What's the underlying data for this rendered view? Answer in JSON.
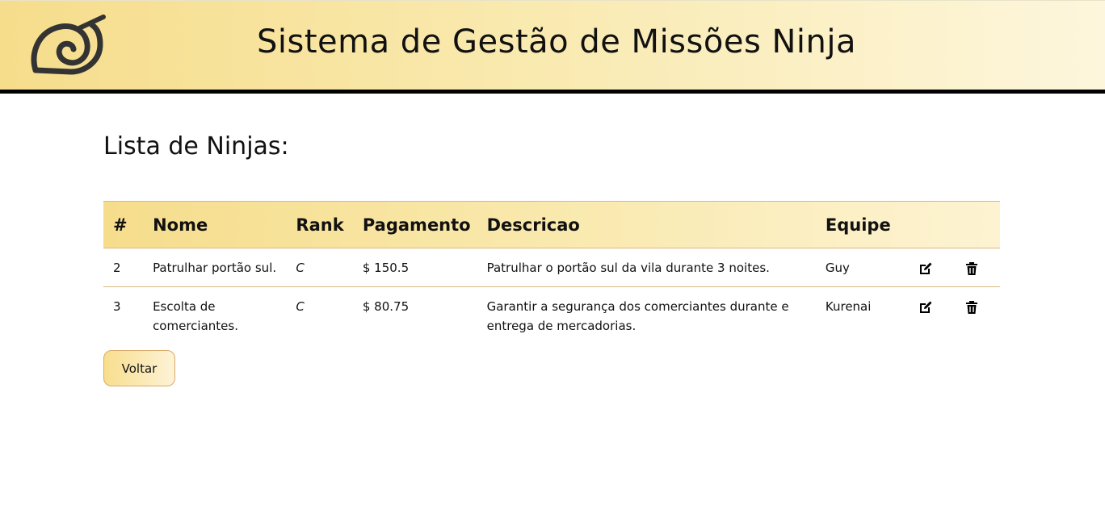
{
  "header": {
    "title": "Sistema de Gestão de Missões Ninja",
    "logo": "leaf-village-icon"
  },
  "page": {
    "title": "Lista de Ninjas:"
  },
  "table": {
    "columns": [
      "#",
      "Nome",
      "Rank",
      "Pagamento",
      "Descricao",
      "Equipe"
    ],
    "rows": [
      {
        "id": "2",
        "nome": "Patrulhar portão sul.",
        "rank": "C",
        "pagamento": "$ 150.5",
        "descricao": "Patrulhar o portão sul da vila durante 3 noites.",
        "equipe": "Guy"
      },
      {
        "id": "3",
        "nome": "Escolta de comerciantes.",
        "rank": "C",
        "pagamento": "$ 80.75",
        "descricao": "Garantir a segurança dos comerciantes durante e entrega de mercadorias.",
        "equipe": "Kurenai"
      }
    ],
    "actions": [
      "edit-icon",
      "trash-icon"
    ]
  },
  "buttons": {
    "back_label": "Voltar"
  },
  "colors": {
    "header_gradient_start": "#f6dd8c",
    "header_gradient_end": "#fdf6dc",
    "border_accent": "#d9b883",
    "header_bottom_border": "#000000"
  }
}
